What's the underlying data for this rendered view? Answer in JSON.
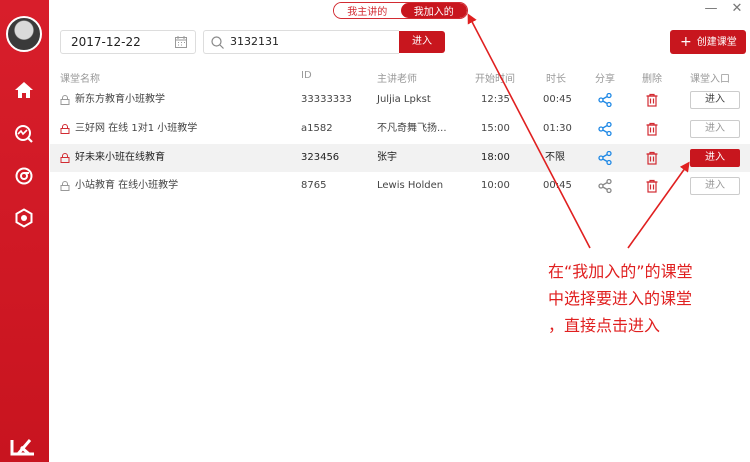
{
  "tabs": [
    {
      "label": "我主讲的",
      "active": false
    },
    {
      "label": "我加入的",
      "active": true
    }
  ],
  "toolbar": {
    "date": "2017-12-22",
    "search_value": "3132131",
    "search_button": "进入",
    "create_button": "创建课堂"
  },
  "table": {
    "headers": {
      "name": "课堂名称",
      "id": "ID",
      "teacher": "主讲老师",
      "start": "开始时间",
      "duration": "时长",
      "share": "分享",
      "delete": "删除",
      "entry": "课堂入口"
    },
    "rows": [
      {
        "name": "新东方教育小班教学",
        "id": "33333333",
        "teacher": "Juljia Lpkst",
        "start": "12:35",
        "duration": "00:45",
        "enter": "进入"
      },
      {
        "name": "三好网 在线 1对1 小班教学",
        "id": "a1582",
        "teacher": "不凡奇舞飞扬...",
        "start": "15:00",
        "duration": "01:30",
        "enter": "进入"
      },
      {
        "name": "好未来小班在线教育",
        "id": "323456",
        "teacher": "张宇",
        "start": "18:00",
        "duration": "不限",
        "enter": "进入"
      },
      {
        "name": "小站教育 在线小班教学",
        "id": "8765",
        "teacher": "Lewis Holden",
        "start": "10:00",
        "duration": "00:45",
        "enter": "进入"
      }
    ]
  },
  "annotation": {
    "line1": "在“我加入的”的课堂",
    "line2": "中选择要进入的课堂",
    "line3": "，直接点击进入"
  },
  "colors": {
    "brand": "#c8161e",
    "annotation": "#e02020",
    "share": "#1e88e5"
  }
}
